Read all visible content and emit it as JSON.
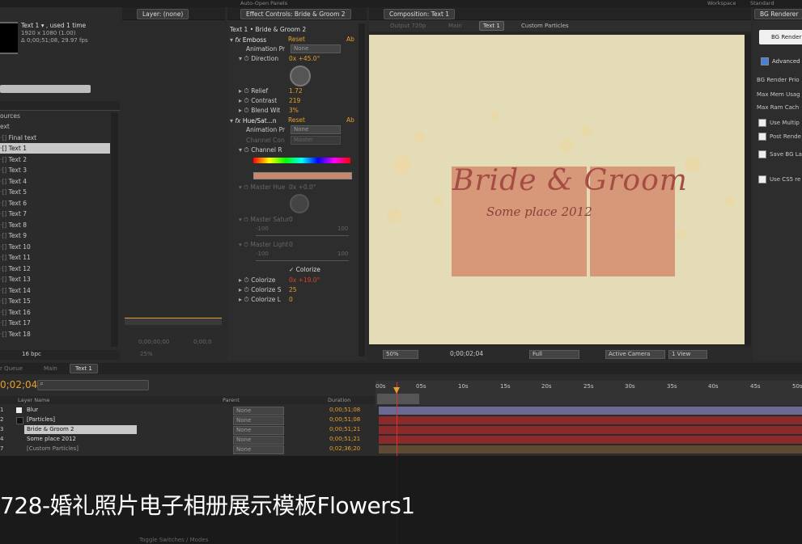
{
  "top": {
    "auto_open_panels": "Auto-Open Panels",
    "workspace_label": "Workspace",
    "workspace_value": "Standard"
  },
  "project": {
    "item_name": "Text 1 ▾ , used 1 time",
    "item_dims": "1920 x 1080 (1.00)",
    "item_duration": "Δ 0;00;51;08, 29.97 fps",
    "folder_sources": "ources",
    "folder_text": "ext",
    "items": [
      "Final text",
      "Text 1",
      "Text 2",
      "Text 3",
      "Text 4",
      "Text 5",
      "Text 6",
      "Text 7",
      "Text 8",
      "Text 9",
      "Text 10",
      "Text 11",
      "Text 12",
      "Text 13",
      "Text 14",
      "Text 15",
      "Text 16",
      "Text 17",
      "Text 18"
    ],
    "bpc": "16 bpc"
  },
  "layer_panel": {
    "tab": "Layer: (none)",
    "time_a": "0;00;00;00",
    "time_b": "0;00;0",
    "zoom": "25%"
  },
  "effects": {
    "tab": "Effect Controls: Bride & Groom 2",
    "breadcrumb": "Text 1 • Bride & Groom 2",
    "emboss": {
      "name": "Emboss",
      "reset": "Reset",
      "about": "Ab",
      "anim_label": "Animation Pr",
      "anim_value": "None",
      "direction_label": "Direction",
      "direction_value": "0x +45.0°",
      "relief_label": "Relief",
      "relief_value": "1.72",
      "contrast_label": "Contrast",
      "contrast_value": "219",
      "blend_label": "Blend Wit",
      "blend_value": "3%"
    },
    "huesat": {
      "name": "Hue/Sat...n",
      "reset": "Reset",
      "about": "Ab",
      "anim_label": "Animation Pr",
      "anim_value": "None",
      "channel_control_label": "Channel Con",
      "channel_control_value": "Master",
      "channel_range_label": "Channel R",
      "master_hue_label": "Master Hue",
      "master_hue_value": "0x +0.0°",
      "master_sat_label": "Master Satur",
      "master_sat_value": "0",
      "sat_min": "-100",
      "sat_max": "100",
      "master_light_label": "Master Light",
      "master_light_value": "0",
      "light_min": "-100",
      "light_max": "100",
      "colorize_label": "Colorize",
      "colorize_hue_label": "Colorize",
      "colorize_hue_value": "0x +19.0°",
      "colorize_sat_label": "Colorize S",
      "colorize_sat_value": "25",
      "colorize_light_label": "Colorize L",
      "colorize_light_value": "0"
    }
  },
  "composition": {
    "tab": "Composition: Text 1",
    "output": "Output 720p",
    "main": "Main",
    "text1": "Text 1",
    "custom_particles": "Custom Particles",
    "title_text": "Bride & Groom",
    "subtitle_text": "Some place 2012",
    "zoom": "50%",
    "time": "0;00;02;04",
    "resolution": "Full",
    "camera": "Active Camera",
    "view": "1 View"
  },
  "bg_renderer": {
    "tab": "BG Renderer",
    "button": "BG Render",
    "advanced": "Advanced",
    "priority": "BG Render Prio",
    "max_mem": "Max Mem Usag",
    "max_ram": "Max Ram Cach",
    "use_multi": "Use Multip",
    "post_render": "Post Rende",
    "save_bg": "Save BG La",
    "use_cs5": "Use CS5 re"
  },
  "timeline": {
    "tabs": [
      "r Queue",
      "Main",
      "Text 1"
    ],
    "current_time": "0;02;04",
    "col_layer_name": "Layer Name",
    "col_parent": "Parent",
    "col_duration": "Duration",
    "ruler": [
      "00s",
      "05s",
      "10s",
      "15s",
      "20s",
      "25s",
      "30s",
      "35s",
      "40s",
      "45s",
      "50s"
    ],
    "layers": [
      {
        "num": "1",
        "name": "Blur",
        "parent": "None",
        "duration": "0;00;51;08",
        "bar": "#6b6a93"
      },
      {
        "num": "2",
        "name": "[Particles]",
        "parent": "None",
        "duration": "0;00;51;08",
        "bar": "#8b2a2a"
      },
      {
        "num": "3",
        "name": "Bride & Groom 2",
        "parent": "None",
        "duration": "0;00;51;21",
        "bar": "#8b2a2a"
      },
      {
        "num": "4",
        "name": "Some place 2012",
        "parent": "None",
        "duration": "0;00;51;21",
        "bar": "#8b2a2a"
      },
      {
        "num": "7",
        "name": "[Custom Particles]",
        "parent": "None",
        "duration": "0;02;36;20",
        "bar": "#5e4a33"
      }
    ],
    "toggle_label": "Toggle Switches / Modes"
  },
  "caption": "728-婚礼照片电子相册展示模板Flowers1"
}
